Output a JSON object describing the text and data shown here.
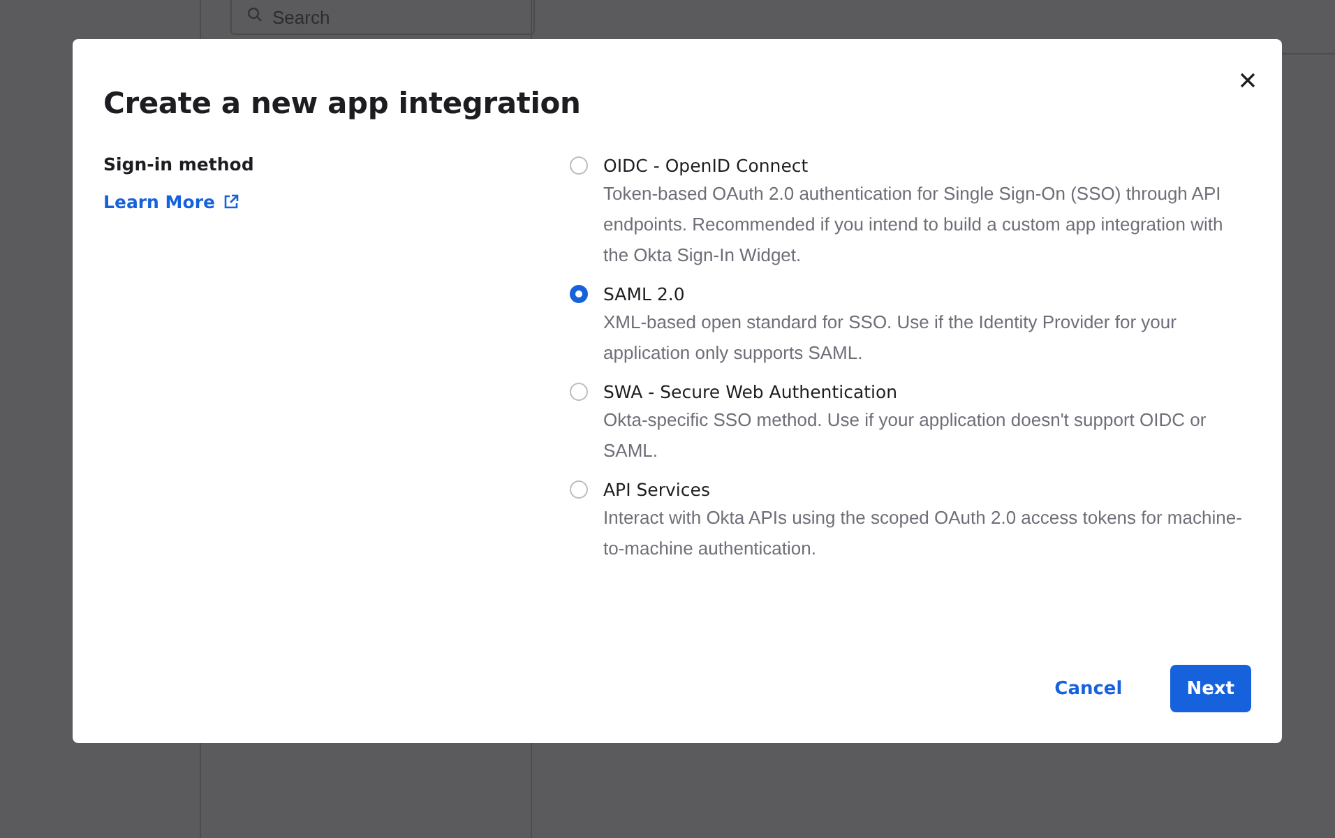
{
  "background": {
    "search": {
      "placeholder": "Search"
    }
  },
  "dialog": {
    "title": "Create a new app integration",
    "field_label": "Sign-in method",
    "link": "Learn More",
    "options": [
      {
        "label": "OIDC - OpenID Connect",
        "description": "Token-based OAuth 2.0 authentication for Single Sign-On (SSO) through API endpoints. Recommended if you intend to build a custom app integration with the Okta Sign-In Widget.",
        "selected": false
      },
      {
        "label": "SAML 2.0",
        "description": "XML-based open standard for SSO. Use if the Identity Provider for your application only supports SAML.",
        "selected": true
      },
      {
        "label": "SWA - Secure Web Authentication",
        "description": "Okta-specific SSO method. Use if your application doesn't support OIDC or SAML.",
        "selected": false
      },
      {
        "label": "API Services",
        "description": "Interact with Okta APIs using the scoped OAuth 2.0 access tokens for machine-to-machine authentication.",
        "selected": false
      }
    ],
    "buttons": [
      {
        "kind": "secondary",
        "label": "Cancel"
      },
      {
        "kind": "primary",
        "label": "Next"
      }
    ]
  }
}
